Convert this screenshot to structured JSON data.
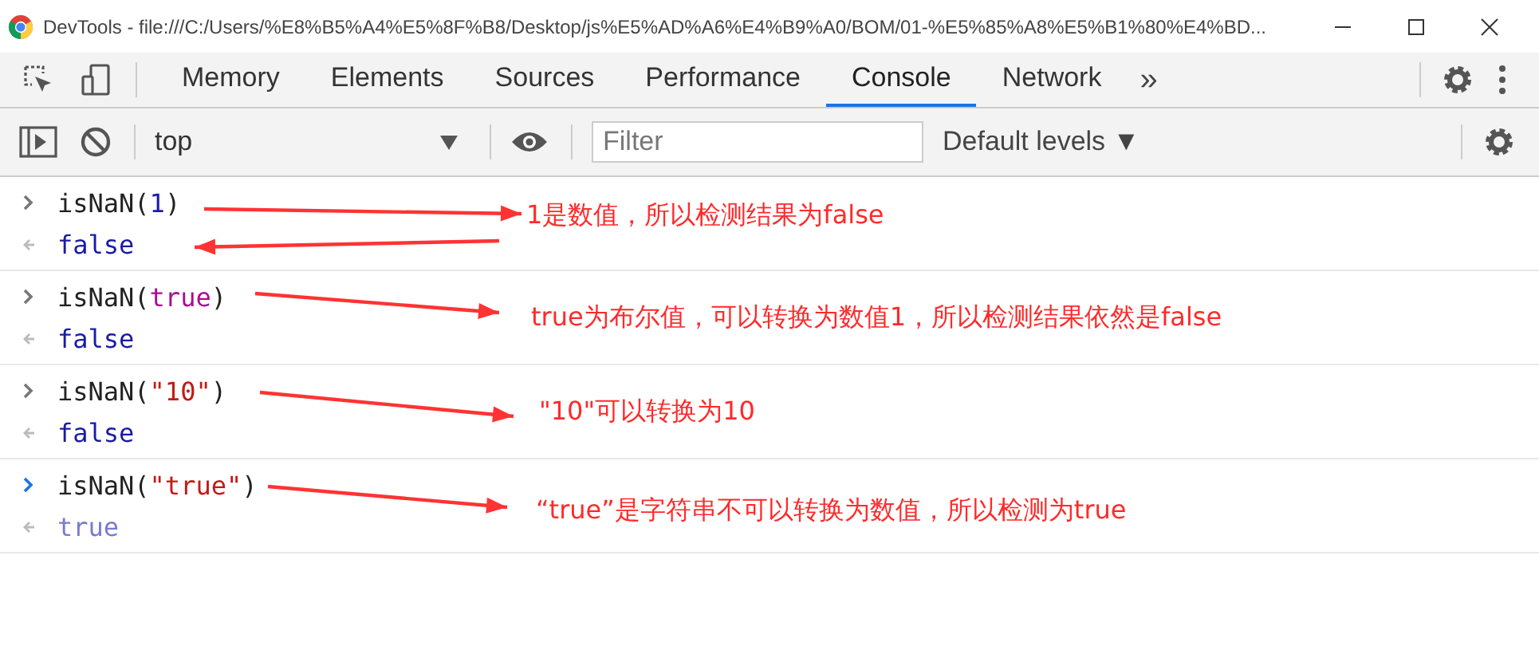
{
  "window": {
    "title": "DevTools - file:///C:/Users/%E8%B5%A4%E5%8F%B8/Desktop/js%E5%AD%A6%E4%B9%A0/BOM/01-%E5%85%A8%E5%B1%80%E4%BD..."
  },
  "tabs": [
    {
      "label": "Memory",
      "selected": false
    },
    {
      "label": "Elements",
      "selected": false
    },
    {
      "label": "Sources",
      "selected": false
    },
    {
      "label": "Performance",
      "selected": false
    },
    {
      "label": "Console",
      "selected": true
    },
    {
      "label": "Network",
      "selected": false
    }
  ],
  "overflow": "»",
  "console_toolbar": {
    "context": "top",
    "filter": {
      "placeholder": "Filter"
    },
    "levels": "Default levels ▼"
  },
  "entries": [
    {
      "kind": "history",
      "tokens": [
        {
          "kind": "plain",
          "text": "isNaN("
        },
        {
          "kind": "number",
          "text": "1"
        },
        {
          "kind": "plain",
          "text": ")"
        }
      ],
      "result": "false"
    },
    {
      "kind": "history",
      "tokens": [
        {
          "kind": "plain",
          "text": "isNaN("
        },
        {
          "kind": "keyword",
          "text": "true"
        },
        {
          "kind": "plain",
          "text": ")"
        }
      ],
      "result": "false"
    },
    {
      "kind": "history",
      "tokens": [
        {
          "kind": "plain",
          "text": "isNaN("
        },
        {
          "kind": "string",
          "text": "\"10\""
        },
        {
          "kind": "plain",
          "text": ")"
        }
      ],
      "result": "false"
    },
    {
      "kind": "prompt",
      "tokens": [
        {
          "kind": "plain",
          "text": "isNaN("
        },
        {
          "kind": "string",
          "text": "\"true\""
        },
        {
          "kind": "plain",
          "text": ")"
        }
      ],
      "result": "true"
    }
  ],
  "annotations": [
    "1是数值，所以检测结果为false",
    "true为布尔值，可以转换为数值1，所以检测结果依然是false",
    "\"10\"可以转换为10",
    "“true”是字符串不可以转换为数值，所以检测为true"
  ]
}
